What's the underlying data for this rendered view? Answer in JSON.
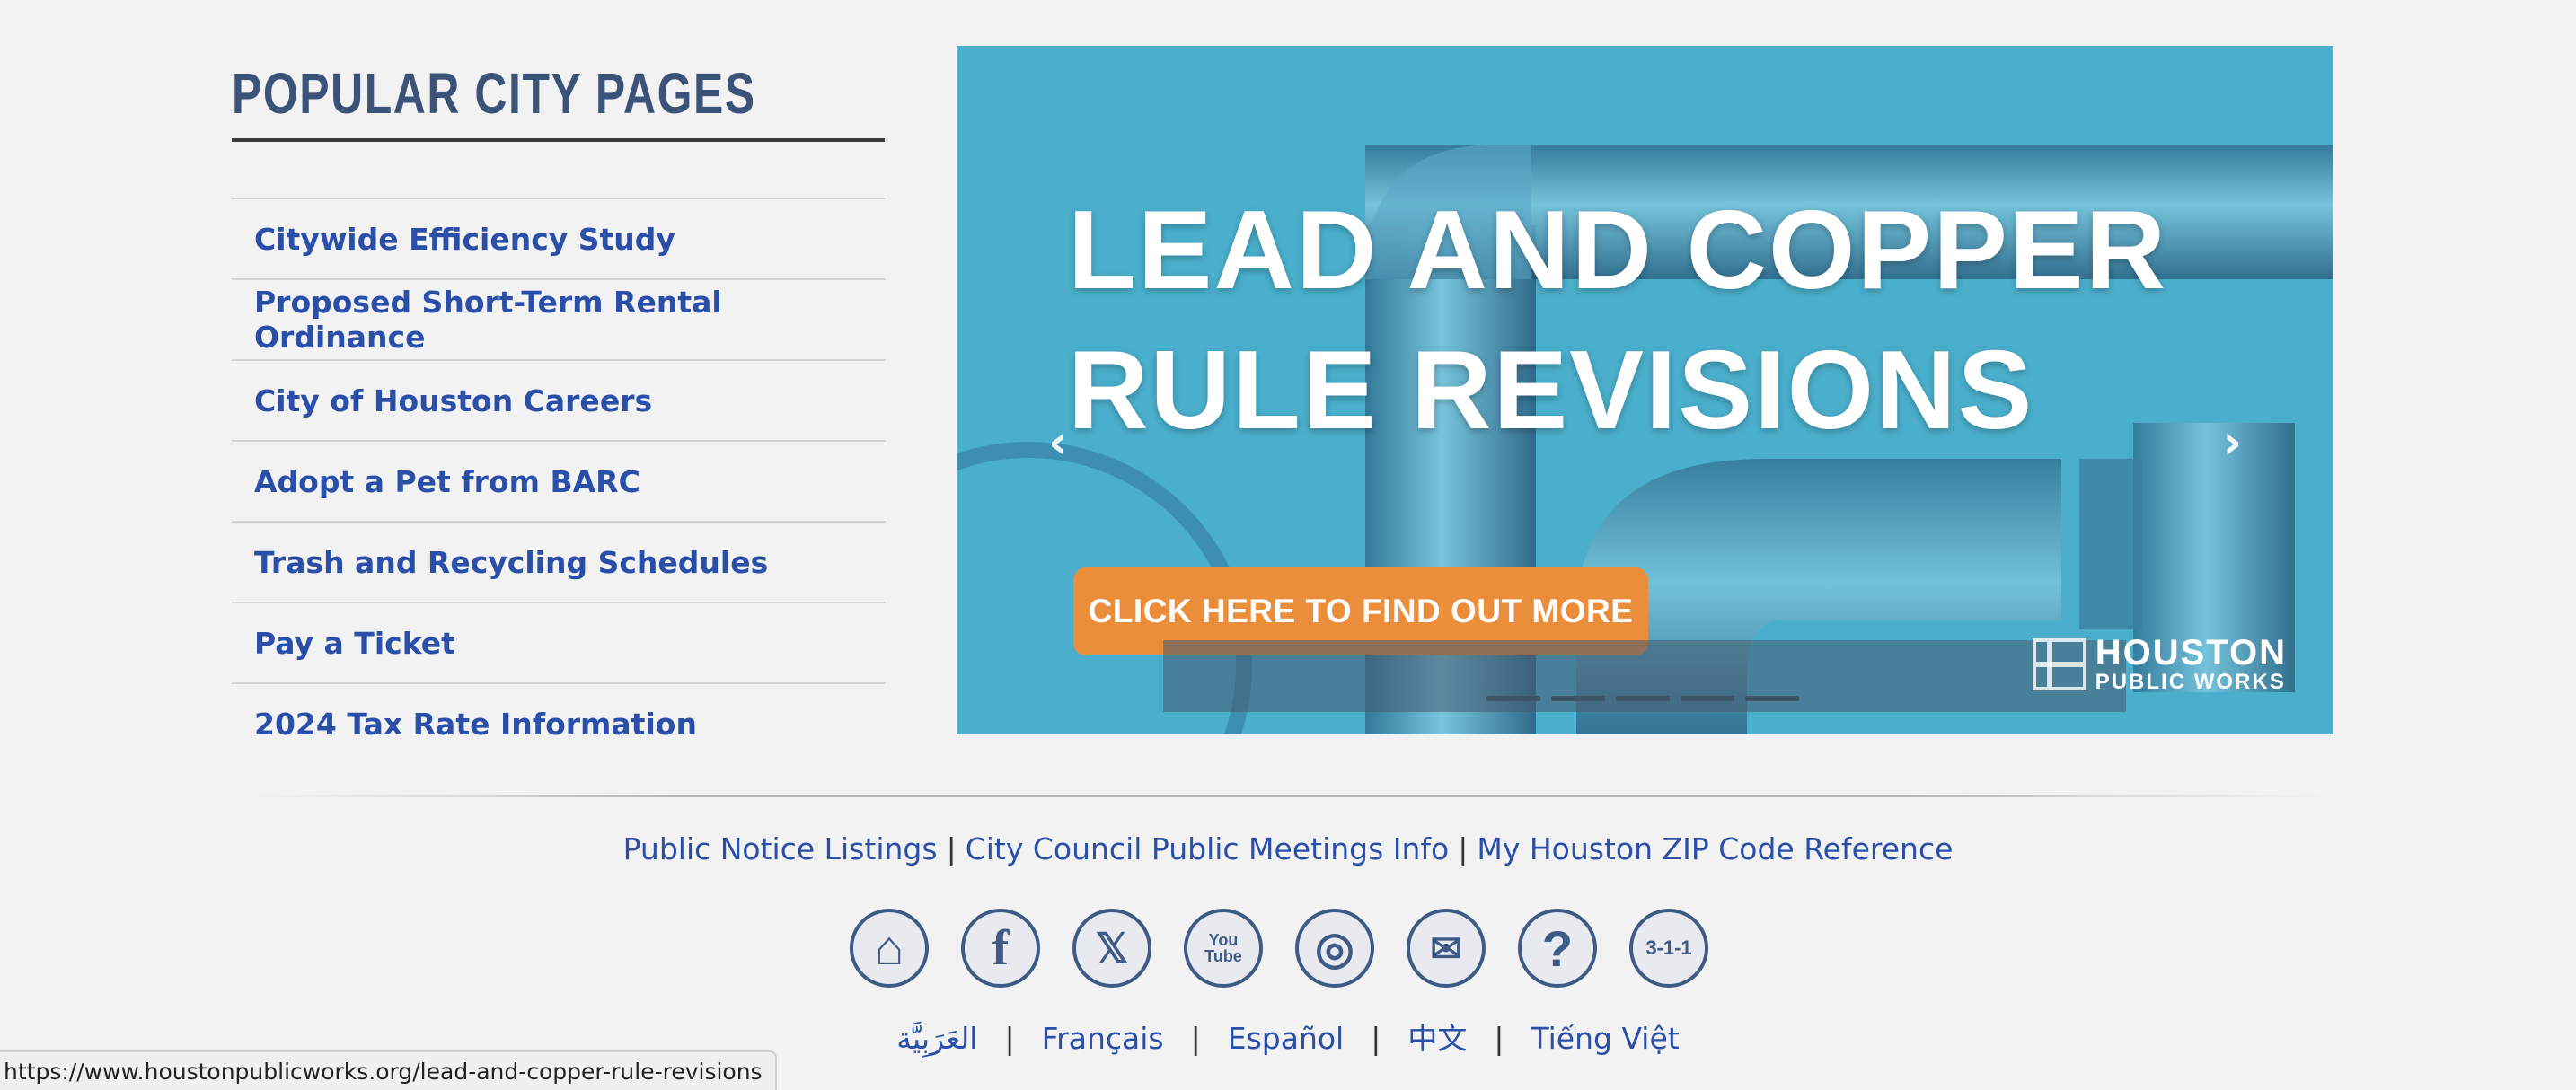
{
  "popular": {
    "title": "POPULAR CITY PAGES",
    "links": [
      "Citywide Efficiency Study",
      "Proposed Short-Term Rental Ordinance",
      "City of Houston Careers",
      "Adopt a Pet from BARC",
      "Trash and Recycling Schedules",
      "Pay a Ticket",
      "2024 Tax Rate Information"
    ]
  },
  "slider": {
    "title_line1": "LEAD AND COPPER",
    "title_line2": "RULE REVISIONS",
    "cta": "CLICK HERE TO FIND OUT MORE",
    "logo_line1": "HOUSTON",
    "logo_line2": "PUBLIC WORKS",
    "prev_glyph": "‹",
    "next_glyph": "›",
    "background_color": "#4aafcc",
    "cta_color": "#ea8e3c"
  },
  "footer": {
    "links": [
      "Public Notice Listings",
      "City Council Public Meetings Info",
      "My Houston ZIP Code Reference"
    ],
    "separator": "|",
    "social": [
      {
        "name": "home-icon",
        "glyph": "⌂"
      },
      {
        "name": "facebook-icon",
        "glyph": "f"
      },
      {
        "name": "x-icon",
        "glyph": "𝕏"
      },
      {
        "name": "youtube-icon",
        "glyph": "You Tube"
      },
      {
        "name": "instagram-icon",
        "glyph": "◎"
      },
      {
        "name": "email-icon",
        "glyph": "✉"
      },
      {
        "name": "help-icon",
        "glyph": "?"
      },
      {
        "name": "311-icon",
        "glyph": "3-1-1"
      }
    ],
    "languages": [
      "العَرَبِيَّة",
      "Français",
      "Español",
      "中文",
      "Tiếng Việt"
    ]
  },
  "status_url": "https://www.houstonpublicworks.org/lead-and-copper-rule-revisions"
}
